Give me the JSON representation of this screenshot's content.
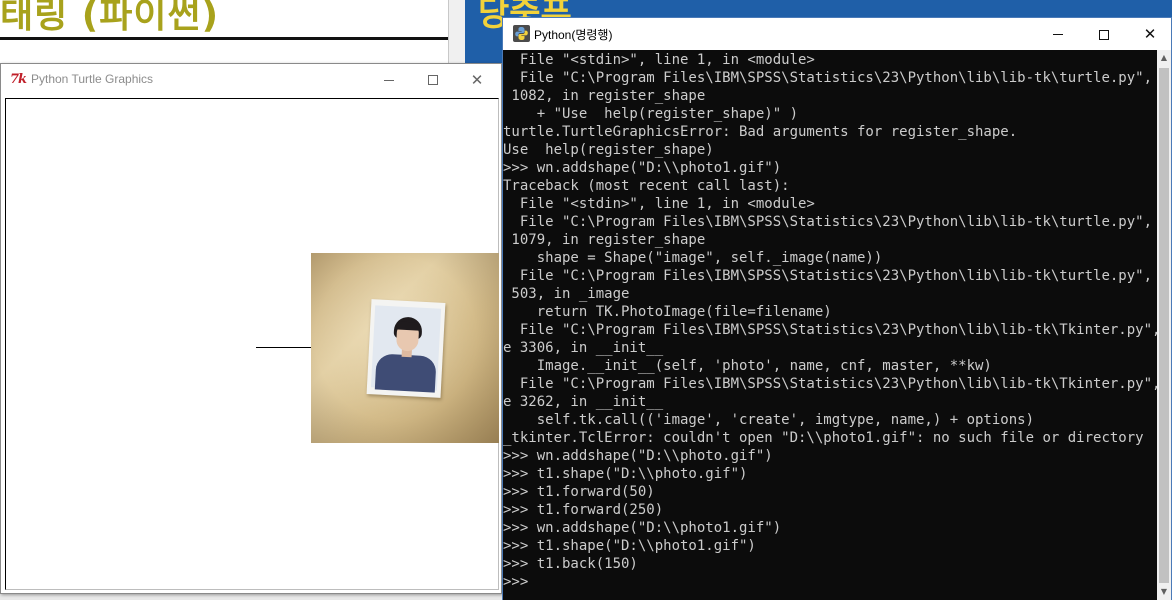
{
  "background": {
    "doc_heading": "태링 (파이썬)",
    "blue_title": "당중퓨"
  },
  "turtle_window": {
    "icon_text": "7k",
    "title": "Python Turtle Graphics",
    "controls": {
      "minimize": "minimize",
      "maximize": "maximize",
      "close": "close"
    }
  },
  "python_window": {
    "title": "Python(명령행)",
    "console_lines": [
      "  File \"<stdin>\", line 1, in <module>",
      "  File \"C:\\Program Files\\IBM\\SPSS\\Statistics\\23\\Python\\lib\\lib-tk\\turtle.py\", line",
      " 1082, in register_shape",
      "    + \"Use  help(register_shape)\" )",
      "turtle.TurtleGraphicsError: Bad arguments for register_shape.",
      "Use  help(register_shape)",
      ">>> wn.addshape(\"D:\\\\photo1.gif\")",
      "Traceback (most recent call last):",
      "  File \"<stdin>\", line 1, in <module>",
      "  File \"C:\\Program Files\\IBM\\SPSS\\Statistics\\23\\Python\\lib\\lib-tk\\turtle.py\", line",
      " 1079, in register_shape",
      "    shape = Shape(\"image\", self._image(name))",
      "  File \"C:\\Program Files\\IBM\\SPSS\\Statistics\\23\\Python\\lib\\lib-tk\\turtle.py\", line",
      " 503, in _image",
      "    return TK.PhotoImage(file=filename)",
      "  File \"C:\\Program Files\\IBM\\SPSS\\Statistics\\23\\Python\\lib\\lib-tk\\Tkinter.py\", lin",
      "e 3306, in __init__",
      "    Image.__init__(self, 'photo', name, cnf, master, **kw)",
      "  File \"C:\\Program Files\\IBM\\SPSS\\Statistics\\23\\Python\\lib\\lib-tk\\Tkinter.py\", lin",
      "e 3262, in __init__",
      "    self.tk.call(('image', 'create', imgtype, name,) + options)",
      "_tkinter.TclError: couldn't open \"D:\\\\photo1.gif\": no such file or directory",
      ">>> wn.addshape(\"D:\\\\photo.gif\")",
      ">>> t1.shape(\"D:\\\\photo.gif\")",
      ">>> t1.forward(50)",
      ">>> t1.forward(250)",
      ">>> wn.addshape(\"D:\\\\photo1.gif\")",
      ">>> t1.shape(\"D:\\\\photo1.gif\")",
      ">>> t1.back(150)",
      ">>>"
    ]
  },
  "colors": {
    "console_bg": "#0c0c0c",
    "console_fg": "#cccccc",
    "heading_olive": "#a8a21c",
    "desktop_blue": "#1f5fa8",
    "tk_icon_red": "#c0202a"
  }
}
